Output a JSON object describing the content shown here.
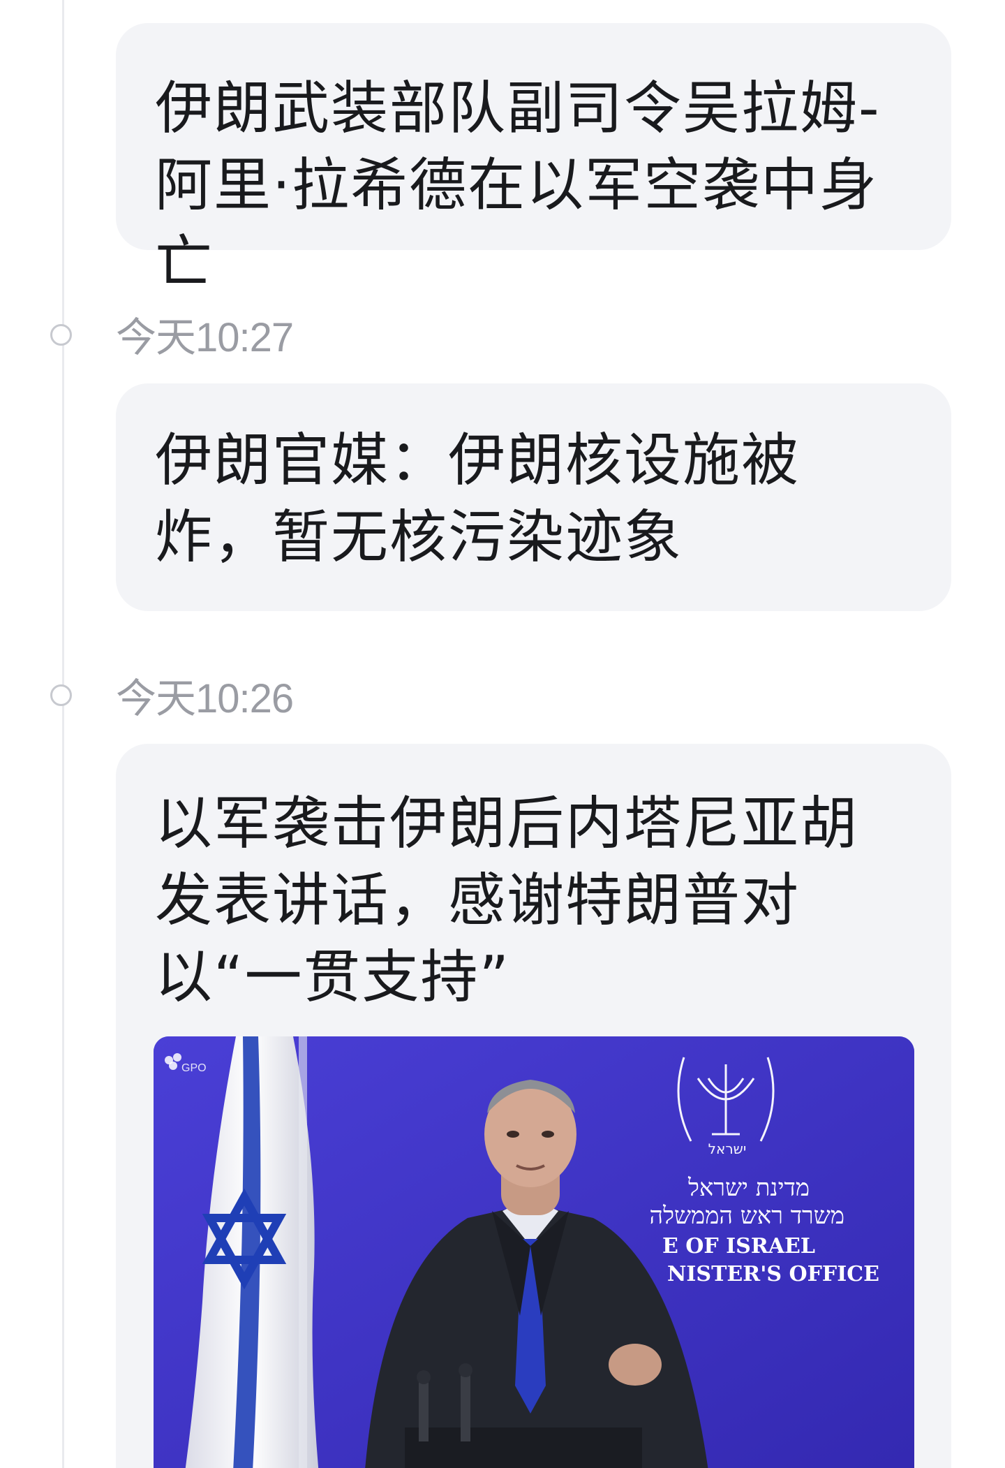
{
  "feed": {
    "items": [
      {
        "headline": "伊朗武装部队副司令吴拉姆-阿里·拉希德在以军空袭中身亡"
      },
      {
        "time": "今天10:27",
        "headline": "伊朗官媒：伊朗核设施被炸，暂无核污染迹象"
      },
      {
        "time": "今天10:26",
        "headline": "以军袭击伊朗后内塔尼亚胡发表讲话，感谢特朗普对以“一贯支持”",
        "image": {
          "watermark": "GPO",
          "emblem_hebrew": "ישראל",
          "sign_line1": "מדינת ישראל",
          "sign_line2": "משרד ראש הממשלה",
          "sign_line3": "E OF ISRAEL",
          "sign_line4": "NISTER'S OFFICE"
        }
      }
    ]
  },
  "colors": {
    "card_bg": "#f3f4f7",
    "timeline": "#e9eaee",
    "time_text": "#9a9ca3",
    "headline_text": "#191a1d",
    "photo_backdrop": "#3f34c8",
    "flag_blue": "#1f3fb6"
  }
}
